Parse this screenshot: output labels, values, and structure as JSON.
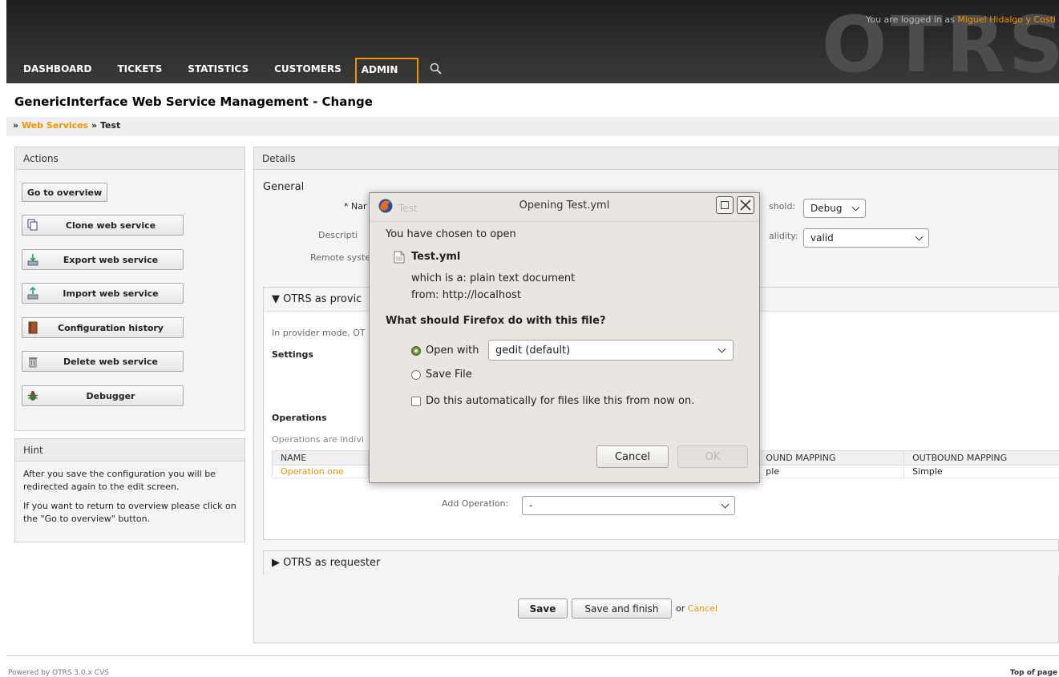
{
  "header": {
    "logo": "OTRS",
    "login_prefix": "You are logged in as",
    "login_user": "Miguel Hidalgo y Costi",
    "nav": [
      {
        "label": "DASHBOARD"
      },
      {
        "label": "TICKETS"
      },
      {
        "label": "STATISTICS"
      },
      {
        "label": "CUSTOMERS"
      },
      {
        "label": "ADMIN",
        "active": true
      }
    ],
    "search_icon": "search-icon"
  },
  "page": {
    "title": "GenericInterface Web Service Management - Change",
    "breadcrumb": {
      "sep": "»",
      "link": "Web Services",
      "current": "Test"
    }
  },
  "actions": {
    "title": "Actions",
    "go_to_overview": "Go to overview",
    "buttons": [
      {
        "label": "Clone web service",
        "icon": "copy-icon"
      },
      {
        "label": "Export web service",
        "icon": "export-icon"
      },
      {
        "label": "Import web service",
        "icon": "import-icon"
      },
      {
        "label": "Configuration history",
        "icon": "book-icon"
      },
      {
        "label": "Delete web service",
        "icon": "trash-icon"
      },
      {
        "label": "Debugger",
        "icon": "bug-icon"
      }
    ]
  },
  "hint": {
    "title": "Hint",
    "p1": "After you save the configuration you will be redirected again to the edit screen.",
    "p2": "If you want to return to overview please click on the \"Go to overview\" button."
  },
  "details": {
    "title": "Details",
    "general": "General",
    "name_label": "* Nar",
    "description_label": "Descripti",
    "remote_label": "Remote syste",
    "threshold_label": "shold:",
    "threshold_value": "Debug",
    "validity_label": "alidity:",
    "validity_value": "valid",
    "provider_section": "▼ OTRS as provic",
    "provider_text": "In provider mode, OT",
    "settings": "Settings",
    "operations": "Operations",
    "operations_text": "Operations are indivi",
    "table": {
      "headers": [
        "NAME",
        "OUND MAPPING",
        "OUTBOUND MAPPING"
      ],
      "rows": [
        [
          "Operation one",
          "ple",
          "Simple"
        ]
      ]
    },
    "add_operation_label": "Add Operation:",
    "add_operation_value": "-",
    "requester_section": "▶ OTRS as requester",
    "save": "Save",
    "save_finish": "Save and finish",
    "or": "or",
    "cancel": "Cancel"
  },
  "footer": {
    "powered": "Powered by OTRS 3.0.x CVS",
    "top": "Top of page"
  },
  "dialog": {
    "ghost_title": "Test",
    "title": "Opening Test.yml",
    "chosen": "You have chosen to open",
    "filename": "Test.yml",
    "which_is": "which is a:  plain text document",
    "from": "from:  http://localhost",
    "question": "What should Firefox do with this file?",
    "open_with": "Open with",
    "open_with_app": "gedit (default)",
    "save_file": "Save File",
    "auto": "Do this automatically for files like this from now on.",
    "cancel": "Cancel",
    "ok": "OK"
  }
}
